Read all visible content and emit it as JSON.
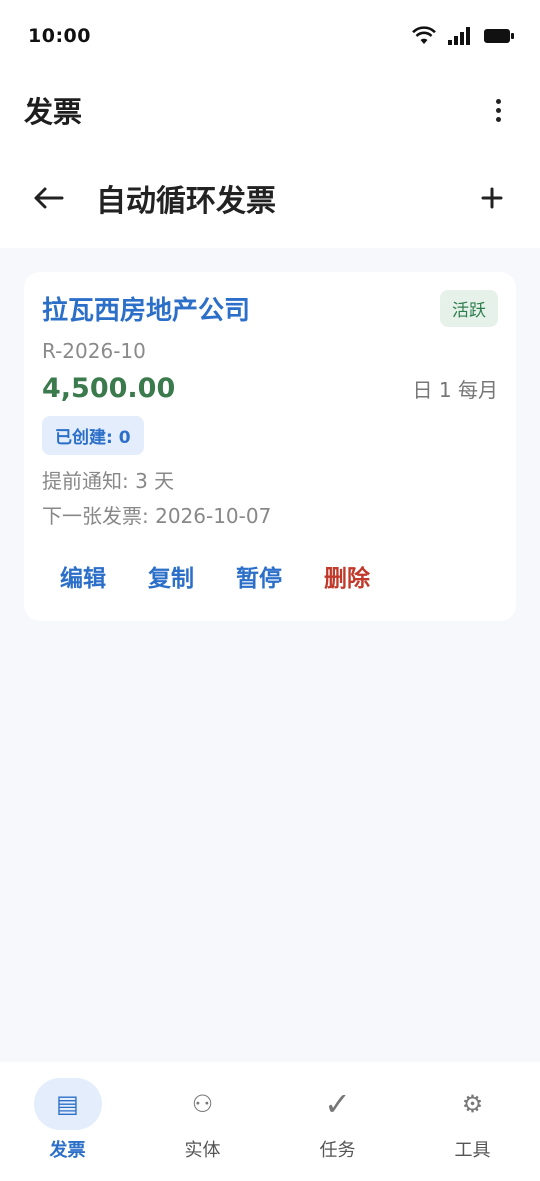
{
  "status_bar": {
    "time": "10:00"
  },
  "app_bar": {
    "title": "发票"
  },
  "sub_header": {
    "title": "自动循环发票"
  },
  "invoice_card": {
    "client": "拉瓦西房地产公司",
    "status": "活跃",
    "number": "R-2026-10",
    "amount": "4,500.00",
    "frequency": "日 1 每月",
    "created": "已创建: 0",
    "notice": "提前通知: 3 天",
    "next_invoice": "下一张发票: 2026-10-07",
    "actions": {
      "edit": "编辑",
      "copy": "复制",
      "pause": "暂停",
      "delete": "删除"
    },
    "colors": {
      "accent": "#2c6fc9",
      "amount": "#3a7a4c",
      "danger": "#c0392b",
      "active_badge_bg": "#e6f2e9"
    }
  },
  "bottom_nav": {
    "items": [
      {
        "label": "发票",
        "icon": "list-icon",
        "glyph": "▤"
      },
      {
        "label": "实体",
        "icon": "entity-icon",
        "glyph": "⚇"
      },
      {
        "label": "任务",
        "icon": "check-icon",
        "glyph": "✓"
      },
      {
        "label": "工具",
        "icon": "gear-icon",
        "glyph": "⚙"
      }
    ]
  }
}
